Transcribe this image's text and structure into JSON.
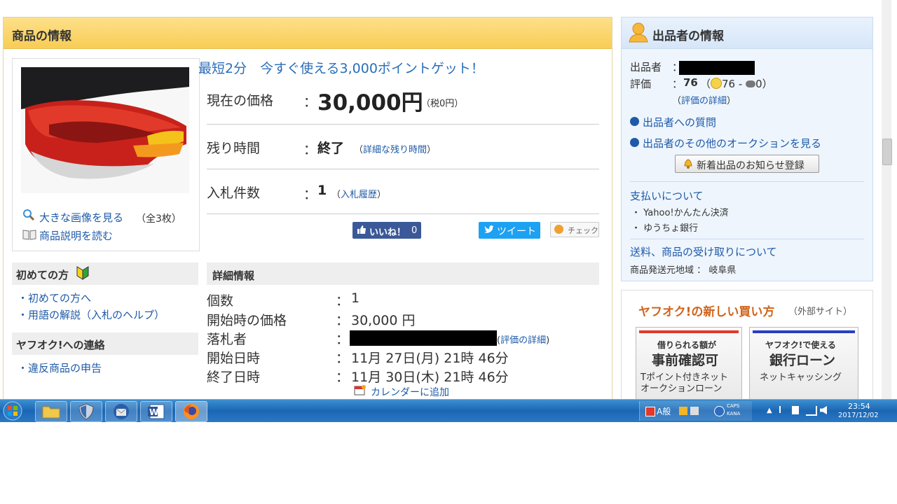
{
  "main": {
    "header_title": "商品の情報",
    "promo_link": "最短2分　今すぐ使える3,000ポイントゲット！",
    "price_label": "現在の価格",
    "colon": "：",
    "price_value": "30,000円",
    "tax_note": "（税0円）",
    "remaining_label": "残り時間",
    "remaining_value": "終了",
    "remaining_link": "詳細な残り時間",
    "bids_label": "入札件数",
    "bids_value": "1",
    "bids_link": "入札履歴",
    "like_label": "いいね！",
    "like_count": "0",
    "tweet_label": "ツイート",
    "check_label": "チェック",
    "view_large_link": "大きな画像を見る",
    "image_count": "（全3枚）",
    "read_description_link": "商品説明を読む"
  },
  "sidebar": {
    "beginner_title": "初めての方",
    "beginner_links": [
      "初めての方へ",
      "用語の解説（入札のヘルプ）"
    ],
    "contact_title": "ヤフオク!への連絡",
    "contact_links": [
      "違反商品の申告"
    ]
  },
  "details": {
    "header": "詳細情報",
    "rows": [
      {
        "label": "個数",
        "value": "1"
      },
      {
        "label": "開始時の価格",
        "value": "30,000 円"
      },
      {
        "label": "落札者",
        "value": ""
      },
      {
        "label": "開始日時",
        "value": "11月 27日(月) 21時 46分"
      },
      {
        "label": "終了日時",
        "value": "11月 30日(木) 21時 46分"
      }
    ],
    "winner_rating_link": "評価の詳細",
    "calendar_link": "カレンダーに追加"
  },
  "seller": {
    "header_title": "出品者の情報",
    "seller_label": "出品者",
    "colon": "：",
    "rating_label": "評価",
    "rating_value": "76",
    "rating_breakdown_good": "76",
    "rating_breakdown_sep": "-",
    "rating_breakdown_bad": "0",
    "rating_detail_link": "評価の詳細",
    "question_link": "出品者への質問",
    "other_auctions_link": "出品者のその他のオークションを見る",
    "notify_button": "新着出品のお知らせ登録",
    "payment_title": "支払いについて",
    "payment_methods": [
      "Yahoo!かんたん決済",
      "ゆうちょ銀行"
    ],
    "shipping_title": "送料、商品の受け取りについて",
    "ship_from_label": "商品発送元地域",
    "ship_from_value": "岐阜県"
  },
  "ad": {
    "title": "ヤフオク!の新しい買い方",
    "subtitle": "（外部サイト）",
    "card1_small": "借りられる額が",
    "card1_big": "事前確認可",
    "card1_desc1": "Tポイント付きネット",
    "card1_desc2": "オークションローン",
    "card2_small": "ヤフオク!で使える",
    "card2_big": "銀行ローン",
    "card2_desc": "ネットキャッシング",
    "card1_color": "#e03a2c",
    "card2_color": "#2a3ec2"
  },
  "taskbar": {
    "time": "23:54",
    "date": "2017/12/02",
    "caps": "CAPS",
    "kana": "KANA",
    "ime": "A般",
    "apps": [
      "folder-icon",
      "security-shield-icon",
      "thunderbird-icon",
      "word-icon",
      "firefox-icon"
    ]
  }
}
